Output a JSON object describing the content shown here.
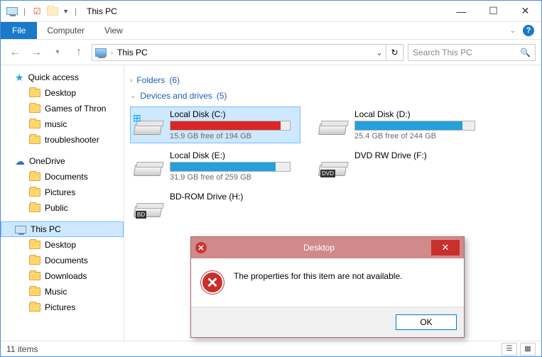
{
  "window": {
    "title": "This PC"
  },
  "ribbon": {
    "file": "File",
    "tabs": [
      "Computer",
      "View"
    ]
  },
  "address": {
    "path": "This PC"
  },
  "search": {
    "placeholder": "Search This PC"
  },
  "nav": {
    "quick": {
      "label": "Quick access",
      "items": [
        "Desktop",
        "Games of Thron",
        "music",
        "troubleshooter"
      ]
    },
    "onedrive": {
      "label": "OneDrive",
      "items": [
        "Documents",
        "Pictures",
        "Public"
      ]
    },
    "thispc": {
      "label": "This PC",
      "items": [
        "Desktop",
        "Documents",
        "Downloads",
        "Music",
        "Pictures"
      ]
    }
  },
  "groups": {
    "folders": {
      "label": "Folders",
      "count": "(6)",
      "expanded": false
    },
    "drives": {
      "label": "Devices and drives",
      "count": "(5)",
      "expanded": true
    }
  },
  "drives": [
    {
      "name": "Local Disk (C:)",
      "free": "15.9 GB free of 194 GB",
      "pct": 92,
      "color": "red",
      "icon": "win",
      "selected": true,
      "bar": true
    },
    {
      "name": "Local Disk (D:)",
      "free": "25.4 GB free of 244 GB",
      "pct": 90,
      "color": "blue",
      "icon": "hdd",
      "selected": false,
      "bar": true
    },
    {
      "name": "Local Disk (E:)",
      "free": "31.9 GB free of 259 GB",
      "pct": 88,
      "color": "blue",
      "icon": "hdd",
      "selected": false,
      "bar": true
    },
    {
      "name": "DVD RW Drive (F:)",
      "free": "",
      "pct": 0,
      "color": "",
      "icon": "dvd",
      "selected": false,
      "bar": false
    },
    {
      "name": "BD-ROM Drive (H:)",
      "free": "",
      "pct": 0,
      "color": "",
      "icon": "bd",
      "selected": false,
      "bar": false
    }
  ],
  "status": {
    "text": "11 items"
  },
  "dialog": {
    "title": "Desktop",
    "message": "The properties for this item are not available.",
    "ok": "OK"
  }
}
